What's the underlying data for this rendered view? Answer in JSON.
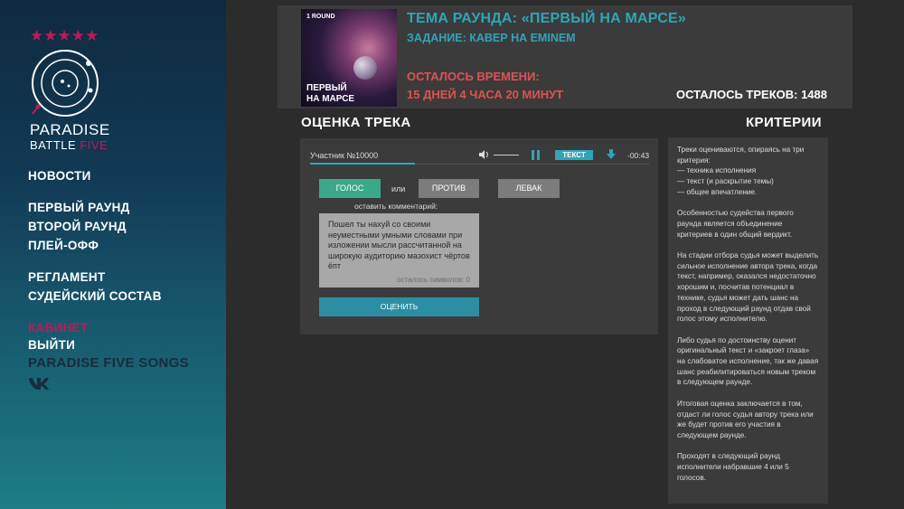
{
  "sidebar": {
    "stars": "★★★★★",
    "brand_line1": "PARADISE",
    "brand_line2_a": "BATTLE ",
    "brand_line2_b": "FIVE",
    "nav": {
      "news": "НОВОСТИ",
      "round1": "ПЕРВЫЙ РАУНД",
      "round2": "ВТОРОЙ РАУНД",
      "playoff": "ПЛЕЙ-ОФФ",
      "rules": "РЕГЛАМЕНТ",
      "judges": "СУДЕЙСКИЙ СОСТАВ",
      "cabinet": "КАБИНЕТ",
      "logout": "ВЫЙТИ",
      "songs": "PARADISE FIVE SONGS"
    },
    "vk_icon": "vk-icon"
  },
  "header": {
    "cover_round": "1 ROUND",
    "cover_title_1": "ПЕРВЫЙ",
    "cover_title_2": "НА МАРСЕ",
    "theme": "ТЕМА РАУНДА:  «ПЕРВЫЙ НА МАРСЕ»",
    "task": "ЗАДАНИЕ: КАВЕР НА EMINEM",
    "time_left_label": "ОСТАЛОСЬ ВРЕМЕНИ:",
    "time_left_value": "15 ДНЕЙ 4 ЧАСА 20 МИНУТ",
    "tracks_left": "ОСТАЛОСЬ ТРЕКОВ: 1488"
  },
  "evaluation": {
    "title": "ОЦЕНКА ТРЕКА",
    "participant": "Участник №10000",
    "text_button": "ТЕКСТ",
    "time": "-00:43",
    "progress": 0.31,
    "voice_button": "ГОЛОС",
    "or": "или",
    "against_button": "ПРОТИВ",
    "levak_button": "ЛЕВАК",
    "comment_label": "оставить комментарий:",
    "comment_text": "Пошел ты нахуй со своими неуместными умными словами при изложении мысли рассчитанной на широкую аудиторию мазохист чёртов ёпт",
    "chars_left": "осталось символов: 0",
    "rate_button": "ОЦЕНИТЬ"
  },
  "criteria": {
    "title": "КРИТЕРИИ",
    "p1": "Треки оцениваются, опираясь на три критерия:\n— техника исполнения\n— текст (и раскрытие темы)\n— общее впечатление.",
    "p2": "Особенностью судейства первого раунда является объединение критериев в один общий вердикт.",
    "p3": "На стадии отбора судья может выделить сильное исполнение автора трека, когда текст, например, оказался недостаточно хорошим и, посчитав потенциал в технике, судья может дать шанс на проход в следующий раунд отдав свой голос этому исполнителю.",
    "p4": "Либо судья по достоинству оценит оригинальный текст и «закроет глаза» на слабоватое исполнение, так же давая шанс реабилитироваться новым треком в следующем раунде.",
    "p5": "Итоговая оценка заключается в том, отдаст ли голос судья автору трека или же будет против его участия в следующем раунде.",
    "p6": "Проходят в следующий раунд исполнители набравшие 4 или 5 голосов."
  },
  "colors": {
    "accent": "#2aa7b9",
    "pink": "#c2185b",
    "red": "#e05151",
    "green": "#3aa98a"
  }
}
